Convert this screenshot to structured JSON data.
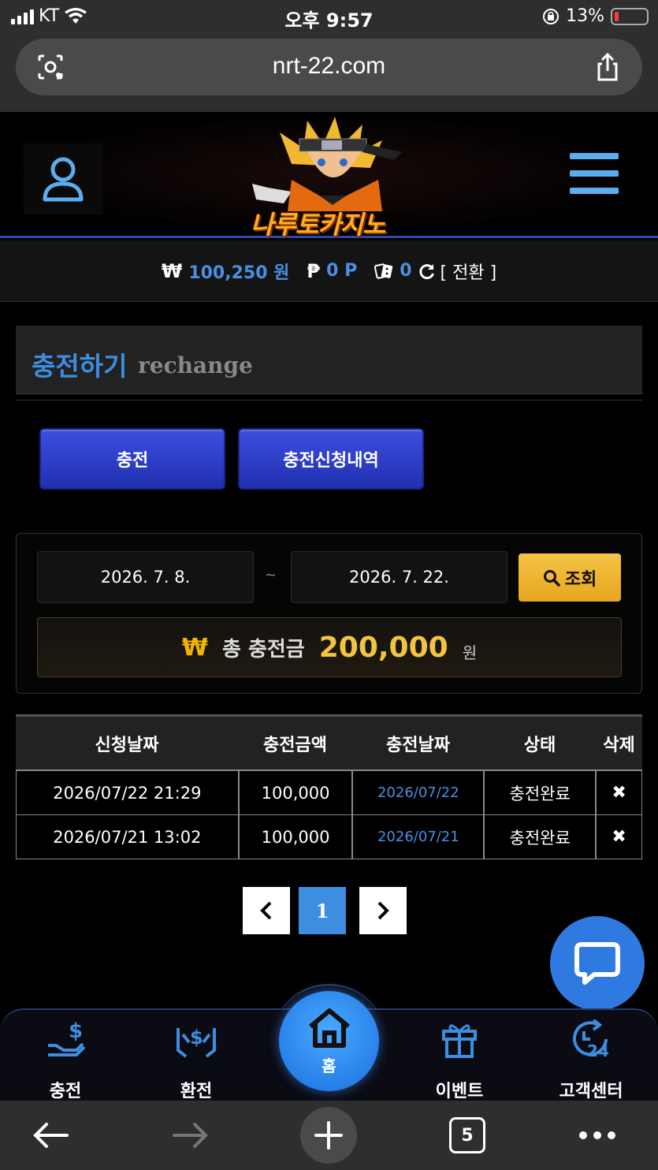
{
  "status_bar": {
    "carrier": "KT",
    "time": "오후 9:57",
    "battery": "13%"
  },
  "browser": {
    "url": "nrt-22.com",
    "tab_count": "5"
  },
  "header": {
    "logo_text": "나루토카지노"
  },
  "balance": {
    "won_symbol": "₩",
    "won_value": "100,250 원",
    "point_symbol": "₱",
    "point_value": "0 P",
    "chip_value": "0",
    "convert_label": "[ 전환 ]"
  },
  "page": {
    "title_ko": "충전하기",
    "title_en": "rechange"
  },
  "tabs": [
    {
      "label": "충전"
    },
    {
      "label": "충전신청내역"
    }
  ],
  "search": {
    "date_from": "2026. 7. 8.",
    "separator": "~",
    "date_to": "2026. 7. 22.",
    "button_label": "조회"
  },
  "total": {
    "symbol": "₩",
    "label": "총 충전금",
    "amount": "200,000",
    "unit": "원"
  },
  "table": {
    "headers": [
      "신청날짜",
      "충전금액",
      "충전날짜",
      "상태",
      "삭제"
    ],
    "rows": [
      {
        "requested": "2026/07/22 21:29",
        "amount": "100,000",
        "charged": "2026/07/22",
        "status": "충전완료",
        "delete": "✖"
      },
      {
        "requested": "2026/07/21 13:02",
        "amount": "100,000",
        "charged": "2026/07/21",
        "status": "충전완료",
        "delete": "✖"
      }
    ]
  },
  "pagination": {
    "prev": "‹",
    "current": "1",
    "next": "›"
  },
  "bottom_nav": {
    "items": [
      {
        "label": "충전",
        "icon": "hand-dollar-icon"
      },
      {
        "label": "환전",
        "icon": "exchange-hands-icon"
      },
      {
        "label": "홈",
        "icon": "home-icon"
      },
      {
        "label": "이벤트",
        "icon": "gift-icon"
      },
      {
        "label": "고객센터",
        "icon": "support-24-icon"
      }
    ]
  },
  "colors": {
    "accent_blue": "#3d8ee0",
    "gold": "#f2c440",
    "tab_blue": "#2f40c8"
  }
}
